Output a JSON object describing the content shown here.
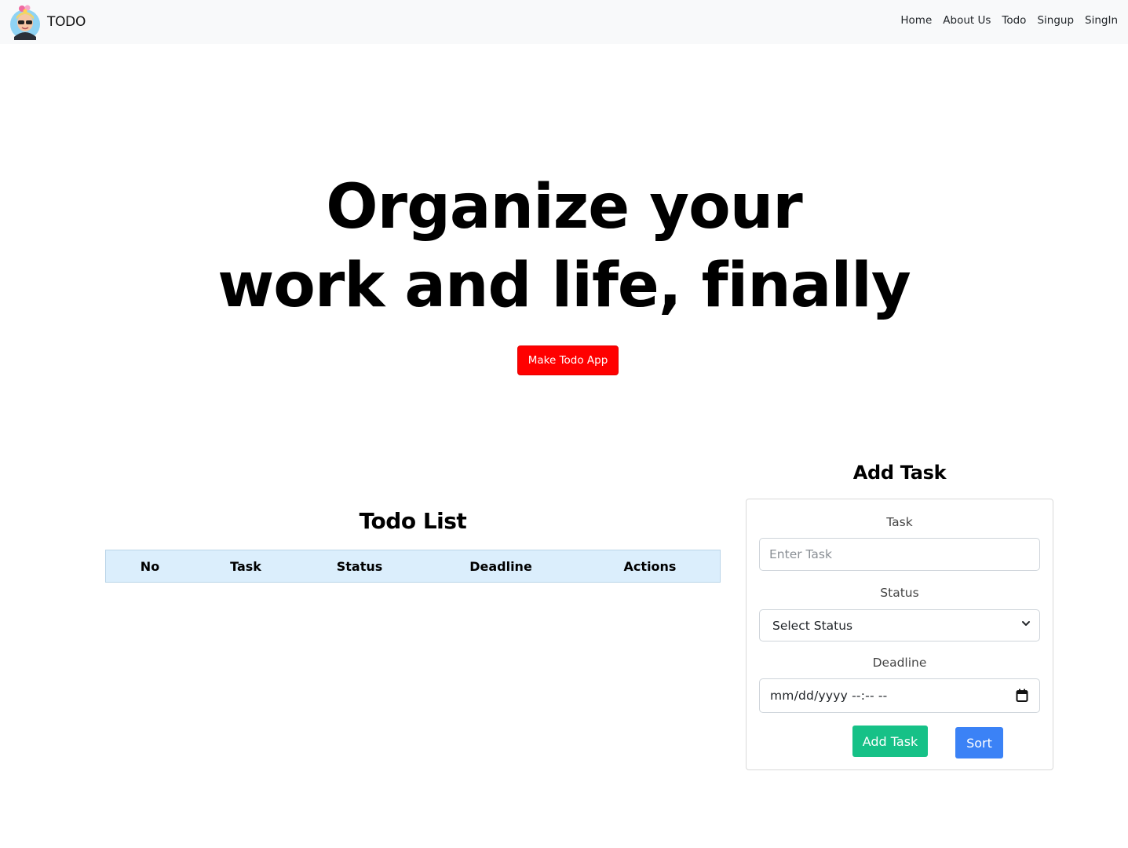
{
  "navbar": {
    "brand": "TODO",
    "links": [
      "Home",
      "About Us",
      "Todo",
      "Singup",
      "SingIn"
    ]
  },
  "hero": {
    "line1": "Organize your",
    "line2": "work and life, finally",
    "cta": "Make Todo App"
  },
  "todo_list": {
    "title": "Todo List",
    "columns": [
      "No",
      "Task",
      "Status",
      "Deadline",
      "Actions"
    ]
  },
  "add_task": {
    "title": "Add Task",
    "task_label": "Task",
    "task_placeholder": "Enter Task",
    "status_label": "Status",
    "status_selected": "Select Status",
    "deadline_label": "Deadline",
    "deadline_placeholder": "mm/dd/yyyy --:-- --",
    "add_button": "Add Task",
    "sort_button": "Sort"
  },
  "colors": {
    "navbar_bg": "#f8f9fa",
    "cta": "#ff0000",
    "table_header": "#dbeefc",
    "add_button": "#16c187",
    "sort_button": "#3b82f6"
  }
}
